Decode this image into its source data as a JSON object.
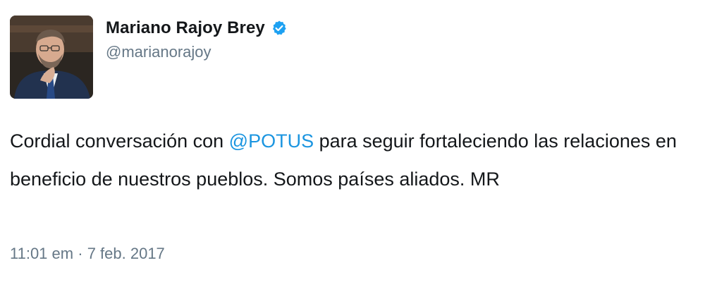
{
  "tweet": {
    "author": {
      "display_name": "Mariano Rajoy Brey",
      "handle": "@marianorajoy",
      "verified": true,
      "avatar_icon": "profile-photo"
    },
    "text": {
      "before": "Cordial conversación con ",
      "mention": "@POTUS",
      "after": " para seguir fortaleciendo las relaciones en beneficio de nuestros pueblos. Somos países aliados. MR"
    },
    "time": "11:01 em",
    "separator": "·",
    "date": "7 feb. 2017"
  },
  "colors": {
    "text": "#14171a",
    "secondary": "#657786",
    "link": "#1b95e0",
    "verified": "#1da1f2"
  }
}
